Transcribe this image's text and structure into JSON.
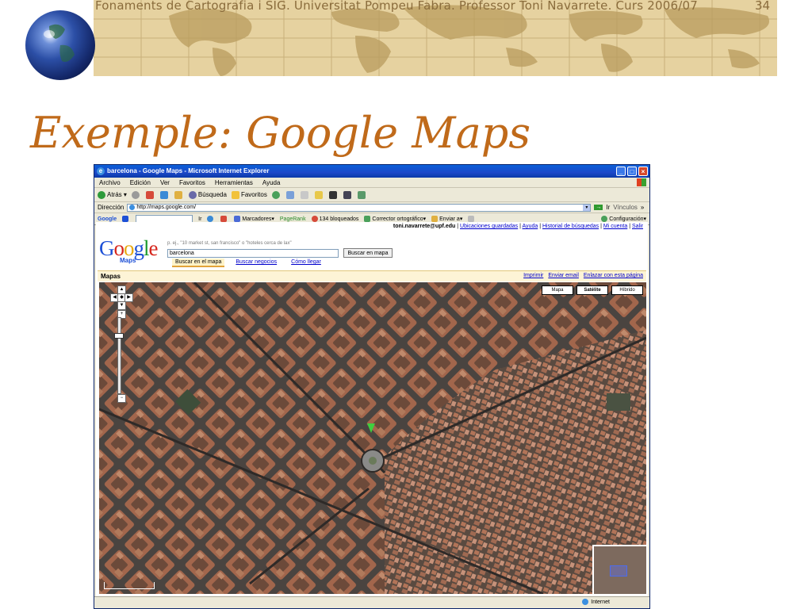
{
  "slide": {
    "header": "Fonaments de Cartografia i SIG. Universitat Pompeu Fabra. Professor Toni Navarrete. Curs 2006/07",
    "page_number": "34",
    "title": "Exemple: Google Maps"
  },
  "browser": {
    "window_title": "barcelona - Google Maps - Microsoft Internet Explorer",
    "menu": [
      "Archivo",
      "Edición",
      "Ver",
      "Favoritos",
      "Herramientas",
      "Ayuda"
    ],
    "toolbar": {
      "back": "Atrás",
      "search": "Búsqueda",
      "favorites": "Favoritos"
    },
    "address": {
      "label": "Dirección",
      "url": "http://maps.google.com/",
      "go": "Ir",
      "links": "Vínculos"
    },
    "google_toolbar": {
      "logo": "Google",
      "go": "Ir",
      "bookmarks": "Marcadores",
      "pagerank": "PageRank",
      "blocked": "134 bloqueados",
      "spellcheck": "Corrector ortográfico",
      "send": "Enviar a",
      "settings": "Configuración"
    },
    "status": {
      "zone": "Internet"
    }
  },
  "gmaps": {
    "user_email": "toni.navarrete@upf.edu",
    "user_links": [
      "Ubicaciones guardadas",
      "Ayuda",
      "Historial de búsquedas",
      "Mi cuenta",
      "Salir"
    ],
    "logo_letters": [
      "G",
      "o",
      "o",
      "g",
      "l",
      "e"
    ],
    "logo_sub": "Maps",
    "search_hint": "p. ej., \"10 market st, san francisco\" o \"hoteles cerca de lax\"",
    "search_value": "barcelona",
    "search_button": "Buscar en mapa",
    "tabs": [
      "Buscar en el mapa",
      "Buscar negocios",
      "Cómo llegar"
    ],
    "maps_label": "Mapas",
    "map_links": [
      "Imprimir",
      "Enviar email",
      "Enlazar con esta página"
    ],
    "map_types": [
      "Mapa",
      "Satélite",
      "Híbrido"
    ],
    "active_map_type": "Satélite"
  }
}
